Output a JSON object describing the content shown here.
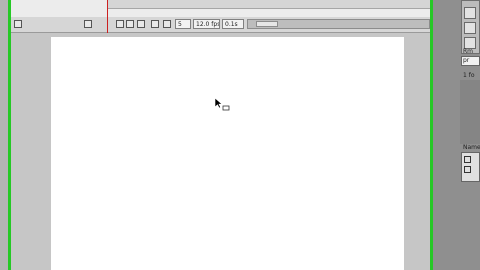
{
  "status_bar": {
    "frame": "5",
    "frame_rate": "12.0 fps",
    "elapsed": "0.1s"
  },
  "right_panel": {
    "label_1": "Rm",
    "label_2": "pr",
    "label_3": "1 fo",
    "label_4": "Name"
  }
}
